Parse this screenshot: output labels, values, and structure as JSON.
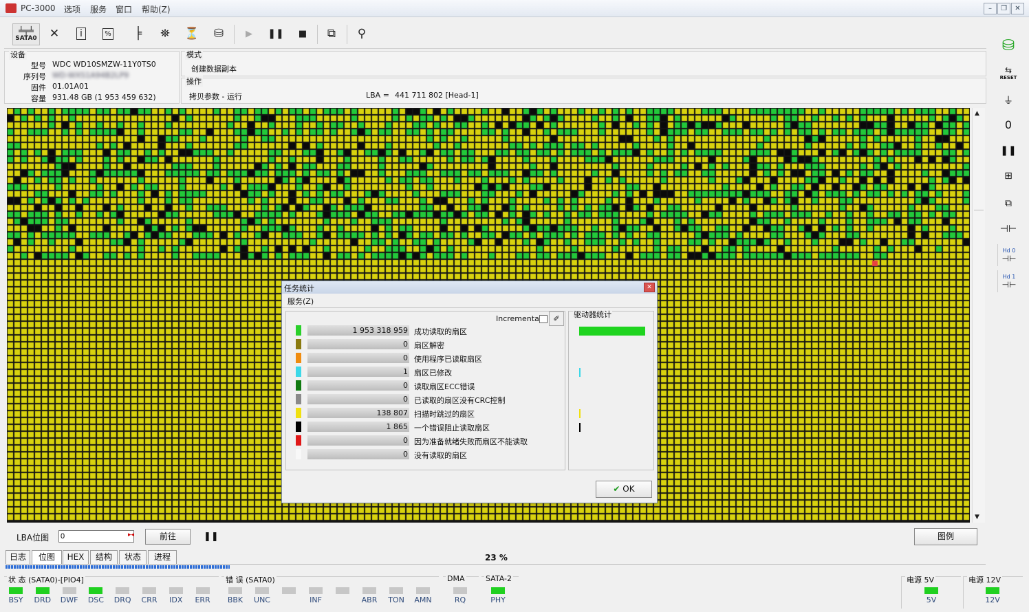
{
  "window": {
    "title": "PC-3000",
    "menu": [
      "选项",
      "服务",
      "窗口",
      "帮助(Z)"
    ]
  },
  "toolbar": {
    "port_label": "SATA0"
  },
  "device": {
    "group_label": "设备",
    "rows": [
      {
        "label": "型号",
        "value": "WDC WD10SMZW-11Y0TS0"
      },
      {
        "label": "序列号",
        "value": "WD-WXS1A94B2LP9"
      },
      {
        "label": "固件",
        "value": "01.01A01"
      },
      {
        "label": "容量",
        "value": "931.48 GB (1 953 459 632)"
      }
    ]
  },
  "mode": {
    "group_label": "模式",
    "value": "创建数据副本"
  },
  "operation": {
    "group_label": "操作",
    "value": "拷贝参数 - 运行",
    "lba_label": "LBA =",
    "lba_value": "441 711 802  [Head-1]"
  },
  "bitmap": {
    "label": "LBA位图",
    "input_value": "0",
    "go_button": "前往",
    "legend_button": "图例",
    "progress": 0.23
  },
  "tabs": [
    "日志",
    "位图",
    "HEX",
    "结构",
    "状态",
    "进程"
  ],
  "progress_text": "23 %",
  "status": {
    "group_label": "状 态 (SATA0)-[PIO4]",
    "leds": [
      {
        "name": "BSY",
        "on": true
      },
      {
        "name": "DRD",
        "on": true
      },
      {
        "name": "DWF",
        "on": false
      },
      {
        "name": "DSC",
        "on": true
      },
      {
        "name": "DRQ",
        "on": false
      },
      {
        "name": "CRR",
        "on": false
      },
      {
        "name": "IDX",
        "on": false
      },
      {
        "name": "ERR",
        "on": false
      }
    ]
  },
  "errors": {
    "group_label": "错 误 (SATA0)",
    "leds": [
      {
        "name": "BBK",
        "on": false
      },
      {
        "name": "UNC",
        "on": false
      },
      {
        "name": "",
        "on": false
      },
      {
        "name": "INF",
        "on": false
      },
      {
        "name": "",
        "on": false
      },
      {
        "name": "ABR",
        "on": false
      },
      {
        "name": "TON",
        "on": false
      },
      {
        "name": "AMN",
        "on": false
      }
    ]
  },
  "dma": {
    "group_label": "DMA",
    "led": "RQ",
    "on": false
  },
  "sata2": {
    "group_label": "SATA-2",
    "led": "PHY",
    "on": true
  },
  "power5": {
    "group_label": "电源 5V",
    "led": "5V",
    "on": true
  },
  "power12": {
    "group_label": "电源 12V",
    "led": "12V",
    "on": true
  },
  "dialog": {
    "title": "任务统计",
    "menu": "服务(Z)",
    "incremental_label": "Incremental",
    "drive_stats_label": "驱动器统计",
    "ok_label": "OK",
    "colors": {
      "green": "#2ad02a",
      "olive": "#8a7a10",
      "orange": "#f08c10",
      "cyan": "#3cd8e8",
      "darkgreen": "#107a10",
      "gray": "#8a8a8a",
      "yellow": "#f0e010",
      "black": "#000000",
      "red": "#e01818",
      "white": "#f8f8f8"
    },
    "rows": [
      {
        "value": "1 953 318 959",
        "label": "成功读取的扇区",
        "color": "#2ad02a"
      },
      {
        "value": "0",
        "label": "扇区解密",
        "color": "#8a7a10"
      },
      {
        "value": "0",
        "label": "使用程序已读取扇区",
        "color": "#f08c10"
      },
      {
        "value": "1",
        "label": "扇区已修改",
        "color": "#3cd8e8"
      },
      {
        "value": "0",
        "label": "读取扇区ECC错误",
        "color": "#107a10"
      },
      {
        "value": "0",
        "label": "已读取的扇区没有CRC控制",
        "color": "#8a8a8a"
      },
      {
        "value": "138 807",
        "label": "扫描时跳过的扇区",
        "color": "#f0e010"
      },
      {
        "value": "1 865",
        "label": "一个错误阻止读取扇区",
        "color": "#000000"
      },
      {
        "value": "0",
        "label": "因为准备就绪失败而扇区不能读取",
        "color": "#e01818"
      },
      {
        "value": "0",
        "label": "没有读取的扇区",
        "color": "#f8f8f8"
      }
    ]
  }
}
